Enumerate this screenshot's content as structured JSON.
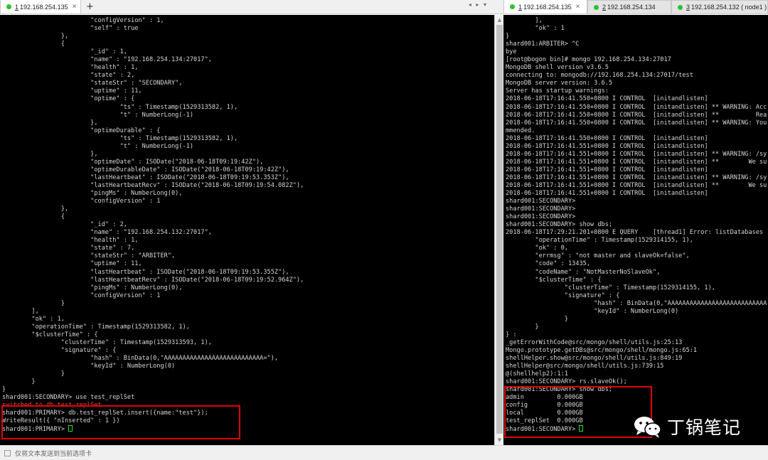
{
  "left_tabs": {
    "tabs": [
      {
        "num": "1",
        "label": "192.168.254.135",
        "active": true
      }
    ],
    "new_tab_label": "+",
    "nav_arrows": "◂ ▸ ▾"
  },
  "right_tabs": {
    "tabs": [
      {
        "num": "1",
        "label": "192.168.254.135",
        "active": true
      },
      {
        "num": "2",
        "label": "192.168.254.134",
        "active": false
      },
      {
        "num": "3",
        "label": "192.168.254.132 ( node1 )",
        "active": false
      }
    ]
  },
  "left_terminal": {
    "lines": [
      "                        \"configVersion\" : 1,",
      "                        \"self\" : true",
      "                },",
      "                {",
      "                        \"_id\" : 1,",
      "                        \"name\" : \"192.168.254.134:27017\",",
      "                        \"health\" : 1,",
      "                        \"state\" : 2,",
      "                        \"stateStr\" : \"SECONDARY\",",
      "                        \"uptime\" : 11,",
      "                        \"optime\" : {",
      "                                \"ts\" : Timestamp(1529313582, 1),",
      "                                \"t\" : NumberLong(-1)",
      "                        },",
      "                        \"optimeDurable\" : {",
      "                                \"ts\" : Timestamp(1529313582, 1),",
      "                                \"t\" : NumberLong(-1)",
      "                        },",
      "                        \"optimeDate\" : ISODate(\"2018-06-18T09:19:42Z\"),",
      "                        \"optimeDurableDate\" : ISODate(\"2018-06-18T09:19:42Z\"),",
      "                        \"lastHeartbeat\" : ISODate(\"2018-06-18T09:19:53.353Z\"),",
      "                        \"lastHeartbeatRecv\" : ISODate(\"2018-06-18T09:19:54.082Z\"),",
      "                        \"pingMs\" : NumberLong(0),",
      "                        \"configVersion\" : 1",
      "                },",
      "                {",
      "                        \"_id\" : 2,",
      "                        \"name\" : \"192.168.254.132:27017\",",
      "                        \"health\" : 1,",
      "                        \"state\" : 7,",
      "                        \"stateStr\" : \"ARBITER\",",
      "                        \"uptime\" : 11,",
      "                        \"lastHeartbeat\" : ISODate(\"2018-06-18T09:19:53.355Z\"),",
      "                        \"lastHeartbeatRecv\" : ISODate(\"2018-06-18T09:19:52.964Z\"),",
      "                        \"pingMs\" : NumberLong(0),",
      "                        \"configVersion\" : 1",
      "                }",
      "        ],",
      "        \"ok\" : 1,",
      "        \"operationTime\" : Timestamp(1529313582, 1),",
      "        \"$clusterTime\" : {",
      "                \"clusterTime\" : Timestamp(1529313593, 1),",
      "                \"signature\" : {",
      "                        \"hash\" : BinData(0,\"AAAAAAAAAAAAAAAAAAAAAAAAAAA=\"),",
      "                        \"keyId\" : NumberLong(0)",
      "                }",
      "        }",
      "}",
      "shard001:SECONDARY> use test_replSet",
      "switched to db test_replSet",
      "shard001:PRIMARY> db.test_replSet.insert({name:\"test\"});",
      "WriteResult({ \"nInserted\" : 1 })",
      "shard001:PRIMARY> "
    ]
  },
  "right_terminal": {
    "lines": [
      "        ],",
      "        \"ok\" : 1",
      "}",
      "shard001:ARBITER> ^C",
      "bye",
      "[root@bogon bin]# mongo 192.168.254.134:27017",
      "MongoDB shell version v3.6.5",
      "connecting to: mongodb://192.168.254.134:27017/test",
      "MongoDB server version: 3.6.5",
      "Server has startup warnings:",
      "2018-06-18T17:16:41.550+0800 I CONTROL  [initandlisten]",
      "2018-06-18T17:16:41.550+0800 I CONTROL  [initandlisten] ** WARNING: Acc",
      "2018-06-18T17:16:41.550+0800 I CONTROL  [initandlisten] **          Rea",
      "2018-06-18T17:16:41.550+0800 I CONTROL  [initandlisten] ** WARNING: You",
      "mmended.",
      "2018-06-18T17:16:41.550+0800 I CONTROL  [initandlisten]",
      "2018-06-18T17:16:41.551+0800 I CONTROL  [initandlisten]",
      "2018-06-18T17:16:41.551+0800 I CONTROL  [initandlisten] ** WARNING: /sy",
      "2018-06-18T17:16:41.551+0800 I CONTROL  [initandlisten] **        We su",
      "2018-06-18T17:16:41.551+0800 I CONTROL  [initandlisten]",
      "2018-06-18T17:16:41.551+0800 I CONTROL  [initandlisten] ** WARNING: /sy",
      "2018-06-18T17:16:41.551+0800 I CONTROL  [initandlisten] **        We su",
      "2018-06-18T17:16:41.551+0800 I CONTROL  [initandlisten]",
      "shard001:SECONDARY>",
      "shard001:SECONDARY>",
      "shard001:SECONDARY>",
      "shard001:SECONDARY> show dbs;",
      "2018-06-18T17:29:21.201+0800 E QUERY    [thread1] Error: listDatabases",
      "        \"operationTime\" : Timestamp(1529314155, 1),",
      "        \"ok\" : 0,",
      "        \"errmsg\" : \"not master and slaveOk=false\",",
      "        \"code\" : 13435,",
      "        \"codeName\" : \"NotMasterNoSlaveOk\",",
      "        \"$clusterTime\" : {",
      "                \"clusterTime\" : Timestamp(1529314155, 1),",
      "                \"signature\" : {",
      "                        \"hash\" : BinData(0,\"AAAAAAAAAAAAAAAAAAAAAAAAAAA",
      "                        \"keyId\" : NumberLong(0)",
      "                }",
      "        }",
      "} :",
      "_getErrorWithCode@src/mongo/shell/utils.js:25:13",
      "Mongo.prototype.getDBs@src/mongo/shell/mongo.js:65:1",
      "shellHelper.show@src/mongo/shell/utils.js:849:19",
      "shellHelper@src/mongo/shell/utils.js:739:15",
      "@(shellhelp2):1:1",
      "shard001:SECONDARY> rs.slaveOk();",
      "shard001:SECONDARY> show dbs;",
      "admin         0.000GB",
      "config        0.000GB",
      "local         0.000GB",
      "test_replSet  0.000GB",
      "shard001:SECONDARY> "
    ]
  },
  "watermark": {
    "text": "丁锅笔记",
    "icon": "wechat-icon"
  },
  "status_bar": {
    "text": "仅将文本发送到当前选项卡"
  },
  "colors": {
    "terminal_bg": "#000000",
    "terminal_fg": "#d6d6d6",
    "annotation": "#e00000",
    "cursor": "#2ede2e",
    "tab_dot": "#2ec12e"
  }
}
